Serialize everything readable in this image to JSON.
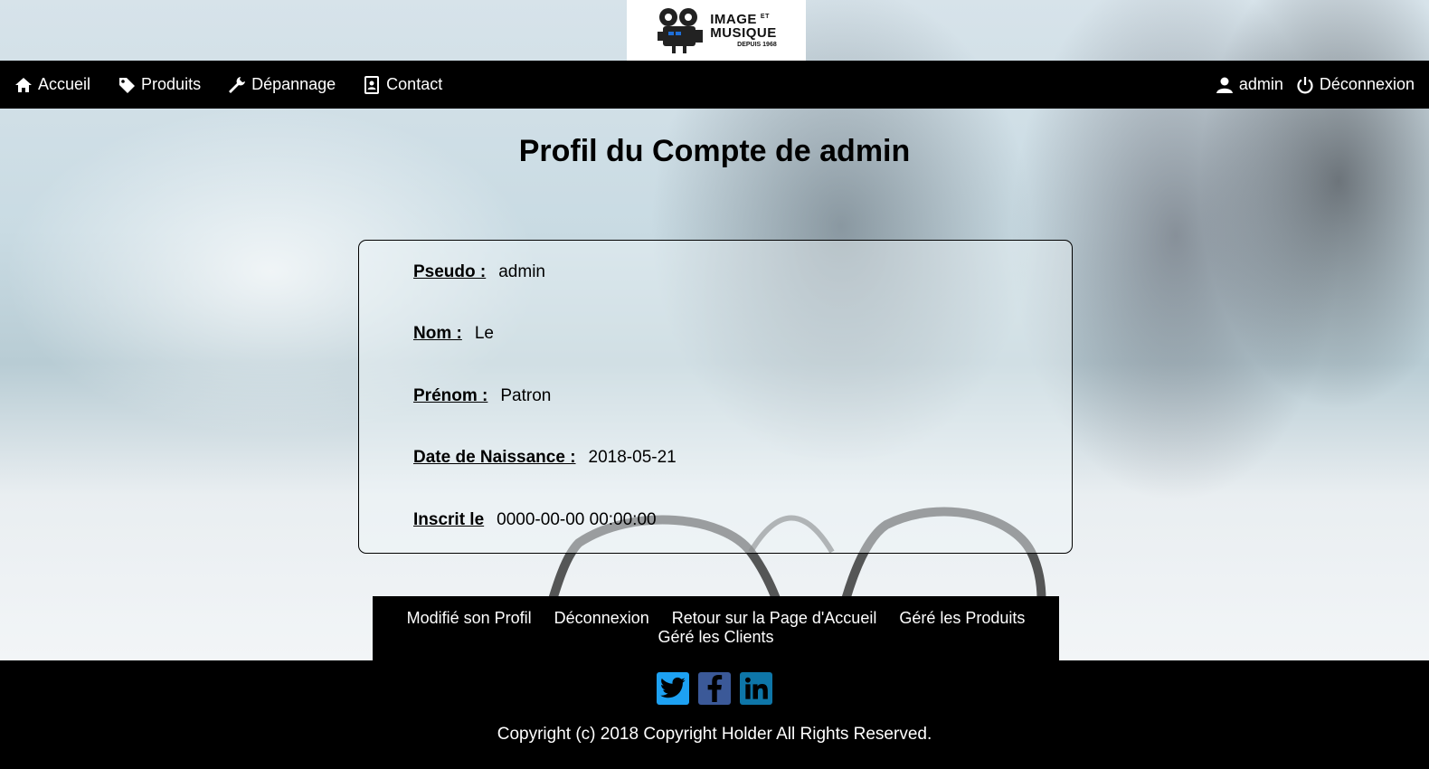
{
  "logo": {
    "line1": "IMAGE",
    "line1_sup": "ET",
    "line2": "MUSIQUE",
    "line3": "DEPUIS 1968"
  },
  "nav": {
    "home": "Accueil",
    "products": "Produits",
    "repair": "Dépannage",
    "contact": "Contact",
    "user": "admin",
    "logout": "Déconnexion"
  },
  "page": {
    "title": "Profil du Compte de admin"
  },
  "profile": {
    "fields": [
      {
        "label": "Pseudo :",
        "value": "admin"
      },
      {
        "label": "Nom :",
        "value": "Le"
      },
      {
        "label": "Prénom :",
        "value": "Patron"
      },
      {
        "label": "Date de Naissance :",
        "value": "2018-05-21"
      },
      {
        "label": "Inscrit le",
        "value": "0000-00-00 00:00:00"
      }
    ]
  },
  "actions": {
    "edit_profile": "Modifié son Profil",
    "logout": "Déconnexion",
    "back_home": "Retour sur la Page d'Accueil",
    "manage_products": "Géré les Produits",
    "manage_clients": "Géré les Clients"
  },
  "footer": {
    "social": [
      "twitter-icon",
      "facebook-icon",
      "linkedin-icon"
    ],
    "colors": {
      "twitter": "#1da1f2",
      "facebook": "#3b5998",
      "linkedin": "#0e76a8"
    },
    "copyright": "Copyright (c) 2018 Copyright Holder All Rights Reserved."
  }
}
